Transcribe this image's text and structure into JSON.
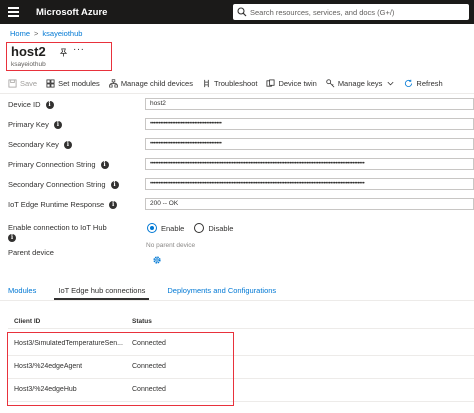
{
  "app": {
    "title": "Microsoft Azure"
  },
  "search": {
    "placeholder": "Search resources, services, and docs (G+/)"
  },
  "breadcrumb": {
    "items": [
      "Home",
      "ksayeiothub"
    ],
    "separator": ">"
  },
  "header": {
    "title": "host2",
    "subtitle": "ksayeiothub",
    "more": "···"
  },
  "toolbar": {
    "save": "Save",
    "set_modules": "Set modules",
    "manage_child_devices": "Manage child devices",
    "troubleshoot": "Troubleshoot",
    "device_twin": "Device twin",
    "manage_keys": "Manage keys",
    "refresh": "Refresh"
  },
  "fields": {
    "device_id": {
      "label": "Device ID",
      "value": "host2"
    },
    "primary_key": {
      "label": "Primary Key",
      "value": "••••••••••••••••••••••••••••••••••••••••••"
    },
    "secondary_key": {
      "label": "Secondary Key",
      "value": "••••••••••••••••••••••••••••••••••••••••••"
    },
    "primary_conn": {
      "label": "Primary Connection String",
      "value": "••••••••••••••••••••••••••••••••••••••••••••••••••••••••••••••••••••••••••••••••••••••••••••••••••••••••••••••••••••••••••••••"
    },
    "secondary_conn": {
      "label": "Secondary Connection String",
      "value": "••••••••••••••••••••••••••••••••••••••••••••••••••••••••••••••••••••••••••••••••••••••••••••••••••••••••••••••••••••••••••••••"
    },
    "runtime_response": {
      "label": "IoT Edge Runtime Response",
      "value": "200 -- OK"
    },
    "enable_connection": {
      "label": "Enable connection to IoT Hub",
      "options": [
        "Enable",
        "Disable"
      ],
      "selected": "Enable"
    },
    "parent_device": {
      "label": "Parent device",
      "value": "No parent device"
    }
  },
  "tabs": [
    "Modules",
    "IoT Edge hub connections",
    "Deployments and Configurations"
  ],
  "active_tab": "IoT Edge hub connections",
  "table": {
    "headers": [
      "Client ID",
      "Status"
    ],
    "rows": [
      [
        "Host3/SimulatedTemperatureSen...",
        "Connected"
      ],
      [
        "Host3/%24edgeAgent",
        "Connected"
      ],
      [
        "Host3/%24edgeHub",
        "Connected"
      ]
    ]
  },
  "colors": {
    "accent": "#0078d4",
    "topbar": "#1b1a19",
    "highlight": "#e8323c"
  }
}
